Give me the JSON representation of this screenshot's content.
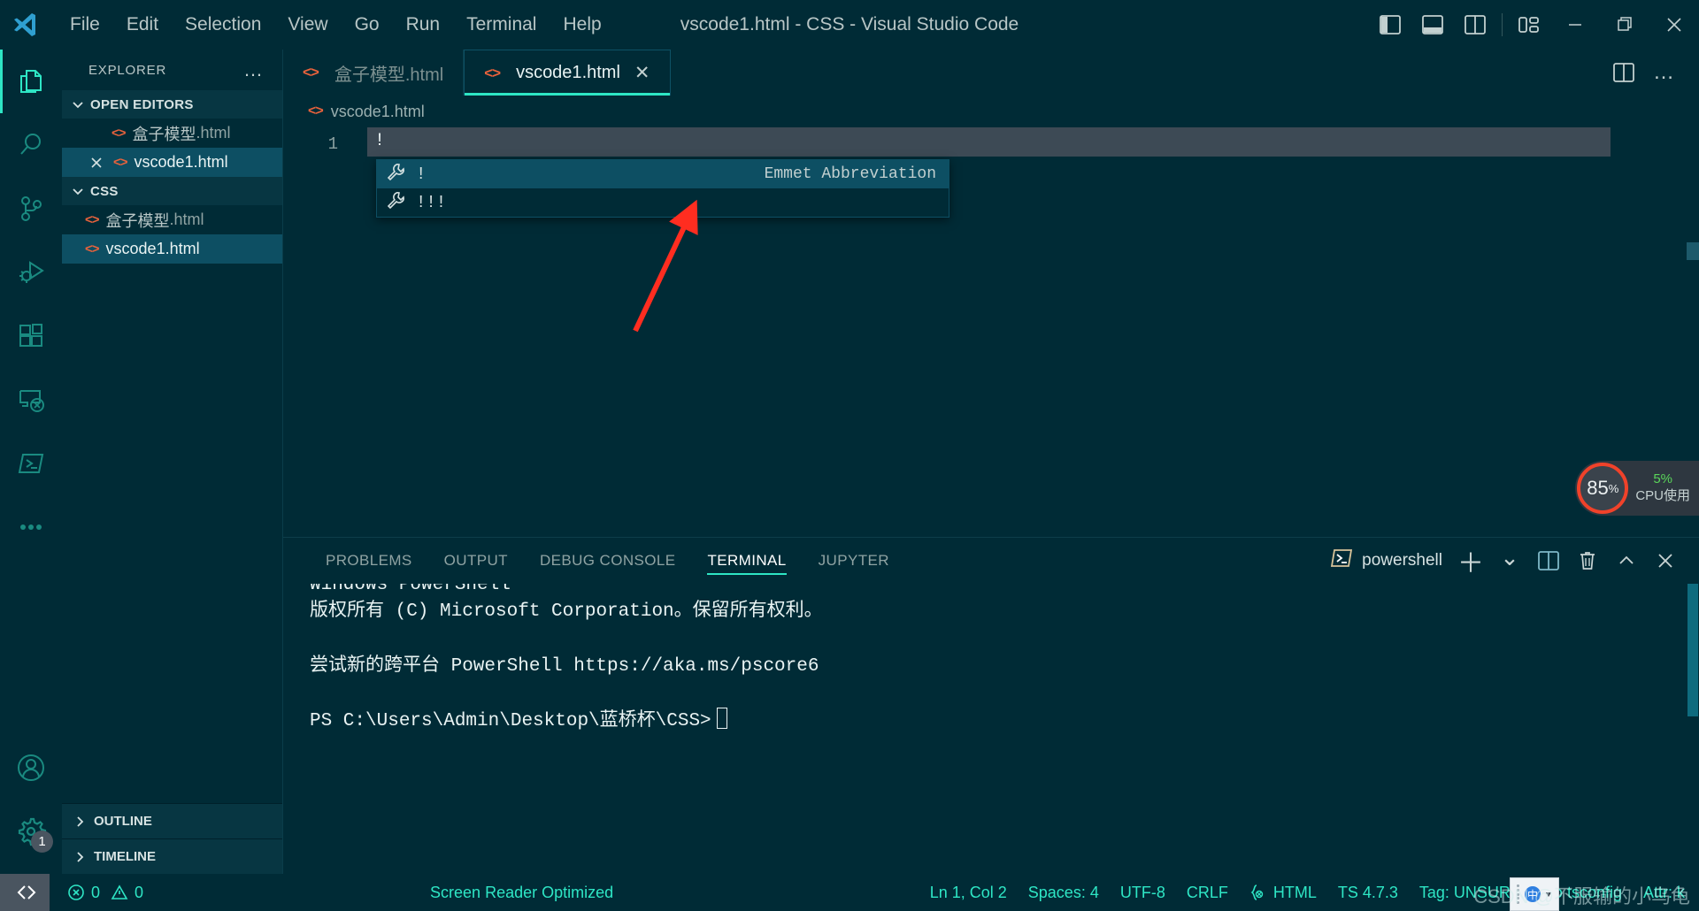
{
  "titlebar": {
    "logo_name": "vscode-logo",
    "menus": [
      "File",
      "Edit",
      "Selection",
      "View",
      "Go",
      "Run",
      "Terminal",
      "Help"
    ],
    "window_title": "vscode1.html - CSS - Visual Studio Code",
    "layout_icons": [
      {
        "name": "toggle-primary-sidebar-icon"
      },
      {
        "name": "toggle-panel-icon"
      },
      {
        "name": "toggle-secondary-sidebar-icon"
      },
      {
        "name": "customize-layout-icon"
      }
    ],
    "window_controls": [
      {
        "name": "minimize-button",
        "glyph": "─"
      },
      {
        "name": "maximize-button",
        "glyph": "❐"
      },
      {
        "name": "close-button",
        "glyph": "✕"
      }
    ]
  },
  "activitybar": {
    "items": [
      {
        "name": "explorer",
        "icon": "files-icon",
        "active": true
      },
      {
        "name": "search",
        "icon": "search-icon",
        "active": false
      },
      {
        "name": "source-control",
        "icon": "source-control-icon",
        "active": false
      },
      {
        "name": "run-and-debug",
        "icon": "debug-icon",
        "active": false
      },
      {
        "name": "extensions",
        "icon": "extensions-icon",
        "active": false
      },
      {
        "name": "remote-explorer",
        "icon": "remote-explorer-icon",
        "active": false
      },
      {
        "name": "terminal-view",
        "icon": "terminal-icon",
        "active": false
      },
      {
        "name": "additional-views",
        "icon": "ellipsis-icon",
        "active": false
      }
    ],
    "bottom": [
      {
        "name": "accounts",
        "icon": "account-icon"
      },
      {
        "name": "manage-settings",
        "icon": "gear-icon",
        "badge": "1"
      }
    ]
  },
  "sidebar": {
    "title": "EXPLORER",
    "more_actions": "…",
    "sections": [
      {
        "name": "open-editors",
        "label": "OPEN EDITORS",
        "expanded": true,
        "rows": [
          {
            "name": "open-editor-boxmodel",
            "label_cn": "盒子模型",
            "label_ext": ".html",
            "icon": "html-icon",
            "selected": false,
            "closable": false
          },
          {
            "name": "open-editor-vscode1",
            "label_cn": "vscode1",
            "label_ext": ".html",
            "icon": "html-icon",
            "selected": true,
            "closable": true
          }
        ]
      },
      {
        "name": "folder-css",
        "label": "CSS",
        "expanded": true,
        "rows": [
          {
            "name": "file-boxmodel",
            "label_cn": "盒子模型",
            "label_ext": ".html",
            "icon": "html-icon",
            "selected": false,
            "closable": false
          },
          {
            "name": "file-vscode1",
            "label_cn": "vscode1",
            "label_ext": ".html",
            "icon": "html-icon",
            "selected": true,
            "closable": false
          }
        ]
      }
    ],
    "collapsed_sections": [
      {
        "name": "outline",
        "label": "OUTLINE"
      },
      {
        "name": "timeline",
        "label": "TIMELINE"
      }
    ]
  },
  "editor": {
    "tabs": [
      {
        "name": "tab-boxmodel",
        "label_cn": "盒子模型",
        "label_ext": ".html",
        "active": false,
        "closable": false
      },
      {
        "name": "tab-vscode1",
        "label_cn": "vscode1",
        "label_ext": ".html",
        "active": true,
        "closable": true,
        "close_glyph": "✕"
      }
    ],
    "tab_actions": [
      {
        "name": "split-editor-right-icon"
      },
      {
        "name": "editor-more-actions-icon",
        "glyph": "…"
      }
    ],
    "breadcrumb": "vscode1.html",
    "line_number": "1",
    "line_text": "!",
    "suggestions": [
      {
        "name": "suggestion-exclaim",
        "icon": "wrench-icon",
        "label": "!",
        "detail": "Emmet Abbreviation",
        "selected": true
      },
      {
        "name": "suggestion-triple-exclaim",
        "icon": "wrench-icon",
        "label": "!!!",
        "detail": "",
        "selected": false
      }
    ]
  },
  "cpu_widget": {
    "name": "cpu-usage-widget",
    "percent": "85",
    "percent_symbol": "%",
    "small_value": "5%",
    "label": "CPU使用",
    "ring_color": "#f0422a"
  },
  "panel": {
    "tabs": [
      {
        "name": "tab-problems",
        "label": "PROBLEMS",
        "active": false
      },
      {
        "name": "tab-output",
        "label": "OUTPUT",
        "active": false
      },
      {
        "name": "tab-debug-console",
        "label": "DEBUG CONSOLE",
        "active": false
      },
      {
        "name": "tab-terminal",
        "label": "TERMINAL",
        "active": true
      },
      {
        "name": "tab-jupyter",
        "label": "JUPYTER",
        "active": false
      }
    ],
    "shell_name": "powershell",
    "shell_icon": "powershell-icon",
    "actions": [
      {
        "name": "new-terminal-button",
        "glyph": "＋"
      },
      {
        "name": "terminal-profile-dropdown-icon",
        "glyph": "⌄"
      },
      {
        "name": "split-terminal-button"
      },
      {
        "name": "kill-terminal-button"
      },
      {
        "name": "maximize-panel-button",
        "glyph": "⌃"
      },
      {
        "name": "close-panel-button",
        "glyph": "✕"
      }
    ],
    "terminal_lines": [
      "Windows PowerShell",
      "版权所有 (C) Microsoft Corporation。保留所有权利。",
      "",
      "尝试新的跨平台 PowerShell https://aka.ms/pscore6",
      "",
      "PS C:\\Users\\Admin\\Desktop\\蓝桥杯\\CSS>"
    ]
  },
  "statusbar": {
    "remote_icon": "remote-window-icon",
    "left": [
      {
        "name": "problems-status",
        "icon": "error-icon",
        "errors": "0",
        "warn_icon": "warning-icon",
        "warnings": "0"
      },
      {
        "name": "screen-reader-status",
        "label": "Screen Reader Optimized"
      }
    ],
    "right": [
      {
        "name": "cursor-position-status",
        "label": "Ln 1, Col 2"
      },
      {
        "name": "indentation-status",
        "label": "Spaces: 4"
      },
      {
        "name": "encoding-status",
        "label": "UTF-8"
      },
      {
        "name": "eol-status",
        "label": "CRLF"
      },
      {
        "name": "language-mode-status",
        "label": "HTML",
        "icon": "braces-icon"
      },
      {
        "name": "typescript-version-status",
        "label": "TS 4.7.3"
      },
      {
        "name": "tag-status",
        "label": "Tag: UNSURE"
      },
      {
        "name": "tsconfig-status",
        "label": "No tsconfig"
      },
      {
        "name": "attr-status",
        "label": "Attr: k"
      }
    ]
  },
  "overlay": {
    "watermark": "CSDN @不服输的小乌龟",
    "ime_name": "ime-candidate-popup"
  }
}
